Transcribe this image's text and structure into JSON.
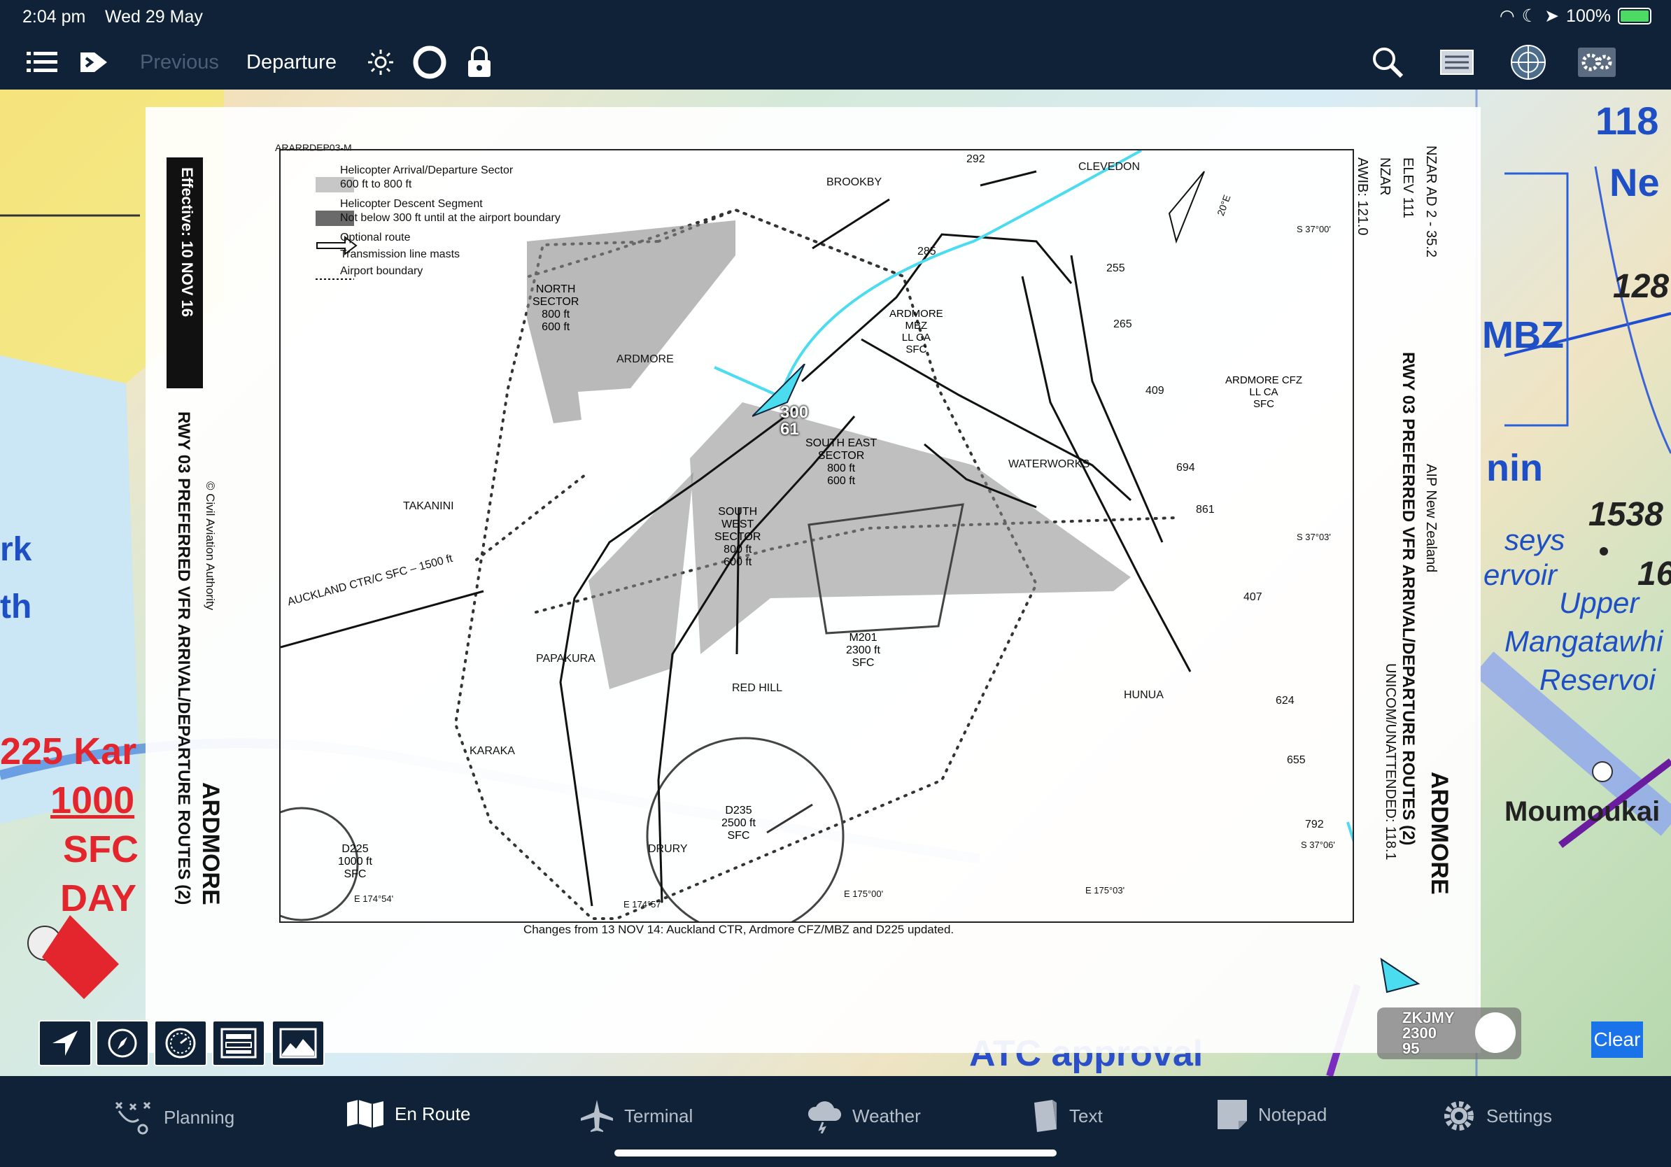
{
  "status": {
    "time": "2:04 pm",
    "date": "Wed 29 May",
    "battery": "100%"
  },
  "toolbar": {
    "previous": "Previous",
    "departure": "Departure"
  },
  "map_labels": {
    "right_numbers": [
      "118",
      "128",
      "1538",
      "16"
    ],
    "places": [
      "Moumoukai",
      "Upper",
      "Mangatawhi",
      "Reservoi",
      "seys",
      "ervoir",
      "Ne",
      "MBZ",
      "nin"
    ],
    "left": [
      "225 Kar",
      "1000",
      "SFC",
      "DAY",
      "rk",
      "th"
    ],
    "bottom": [
      "ATC approval"
    ]
  },
  "plate": {
    "ref": "ARARRDEP03-M",
    "effective": "Effective: 10 NOV 16",
    "title_left": "RWY 03 PREFERRED VFR ARRIVAL/DEPARTURE ROUTES (2)",
    "ardmore_left": "ARDMORE",
    "copyright": "© Civil Aviation Authority",
    "nzar_ad": "NZAR AD 2 - 35.2",
    "elev": "ELEV 111",
    "nzar": "NZAR",
    "awib": "AWIB: 121.0",
    "aip": "AIP New Zealand",
    "title_right": "RWY 03 PREFERRED VFR ARRIVAL/DEPARTURE ROUTES (2)",
    "ardmore_right": "ARDMORE",
    "unicom": "UNICOM/UNATTENDED: 118.1",
    "changes": "Changes from 13 NOV 14: Auckland CTR, Ardmore CFZ/MBZ and D225 updated.",
    "legend": [
      "Helicopter Arrival/Departure Sector",
      "600 ft to 800 ft",
      "Helicopter Descent Segment",
      "Not below 300 ft until at the airport boundary",
      "Optional route",
      "Transmission line masts",
      "Airport boundary"
    ],
    "sectors": {
      "north": [
        "NORTH",
        "SECTOR",
        "800 ft",
        "600 ft"
      ],
      "southeast": [
        "SOUTH EAST",
        "SECTOR",
        "800 ft",
        "600 ft"
      ],
      "southwest": [
        "SOUTH",
        "WEST",
        "SECTOR",
        "800 ft",
        "600 ft"
      ]
    },
    "places": [
      "BROOKBY",
      "CLEVEDON",
      "ARDMORE",
      "TAKANINI",
      "WATERWORKS",
      "PAPAKURA",
      "RED HILL",
      "KARAKA",
      "DRURY",
      "HUNUA"
    ],
    "ardmore_mbz": [
      "ARDMORE",
      "MBZ",
      "LL CA",
      "SFC"
    ],
    "ardmore_cfz": [
      "ARDMORE CFZ",
      "LL CA",
      "SFC"
    ],
    "auckland_ctr": "AUCKLAND CTR/C SFC – 1500 ft",
    "m201": [
      "M201",
      "2300 ft",
      "SFC"
    ],
    "d235": [
      "D235",
      "2500 ft",
      "SFC"
    ],
    "d225": [
      "D225",
      "1000 ft",
      "SFC"
    ],
    "masts": [
      "292",
      "255",
      "265",
      "409",
      "694",
      "861",
      "407",
      "624",
      "655",
      "792",
      "285"
    ],
    "coords": [
      "S 37°00'",
      "S 37°03'",
      "S 37°06'",
      "E 174°54'",
      "E 174°57'",
      "E 175°00'",
      "E 175°03'",
      "20°E"
    ]
  },
  "aircraft": {
    "alt": "300",
    "speed": "61"
  },
  "traffic": {
    "callsign": "ZKJMY",
    "alt": "2300",
    "speed": "95"
  },
  "clear_label": "Clear",
  "tabs": [
    {
      "label": "Planning",
      "icon": "planning-icon"
    },
    {
      "label": "En Route",
      "icon": "map-icon"
    },
    {
      "label": "Terminal",
      "icon": "airplane-icon"
    },
    {
      "label": "Weather",
      "icon": "cloud-icon"
    },
    {
      "label": "Text",
      "icon": "document-icon"
    },
    {
      "label": "Notepad",
      "icon": "notepad-icon"
    },
    {
      "label": "Settings",
      "icon": "gear-icon"
    }
  ]
}
